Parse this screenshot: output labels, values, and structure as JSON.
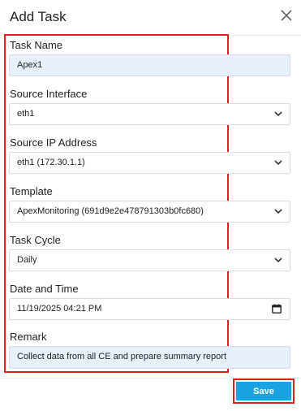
{
  "dialog": {
    "title": "Add Task"
  },
  "form": {
    "task_name": {
      "label": "Task Name",
      "value": "Apex1"
    },
    "source_interface": {
      "label": "Source Interface",
      "value": "eth1"
    },
    "source_ip": {
      "label": "Source IP Address",
      "value": "eth1 (172.30.1.1)"
    },
    "template": {
      "label": "Template",
      "value": "ApexMonitoring (691d9e2e478791303b0fc680)"
    },
    "task_cycle": {
      "label": "Task Cycle",
      "value": "Daily"
    },
    "date_time": {
      "label": "Date and Time",
      "value": "11/19/2025 04:21 PM"
    },
    "remark": {
      "label": "Remark",
      "value": "Collect data from all CE and prepare summary report"
    }
  },
  "footer": {
    "save_label": "Save"
  },
  "colors": {
    "accent": "#1aa3e0",
    "highlight": "#e02020",
    "filled_bg": "#e8f0fe"
  },
  "icons": {
    "close": "close-icon",
    "dropdown": "chevron-down-icon",
    "calendar": "calendar-icon"
  }
}
